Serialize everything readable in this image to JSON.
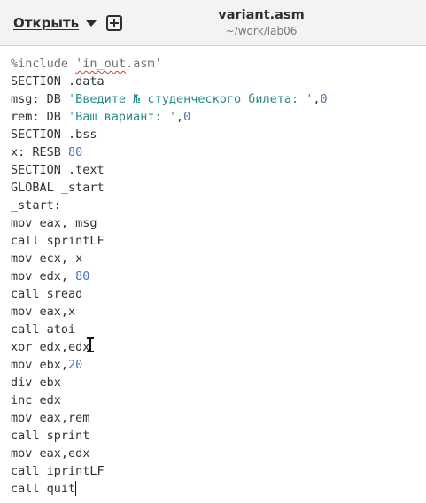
{
  "header": {
    "open_label": "Открыть",
    "title": "variant.asm",
    "subtitle": "~/work/lab06",
    "icons": {
      "open_menu": "chevron-down-icon",
      "new_tab": "new-document-icon"
    }
  },
  "editor": {
    "lines": [
      [
        {
          "t": "%include ",
          "c": "dir"
        },
        {
          "t": "'in_out",
          "c": "dir misspelled"
        },
        {
          "t": ".asm'",
          "c": "dir"
        }
      ],
      [
        {
          "t": "SECTION .data",
          "c": ""
        }
      ],
      [
        {
          "t": "msg: DB ",
          "c": ""
        },
        {
          "t": "'Введите № студенческого билета: '",
          "c": "str"
        },
        {
          "t": ",",
          "c": ""
        },
        {
          "t": "0",
          "c": "num"
        }
      ],
      [
        {
          "t": "rem: DB ",
          "c": ""
        },
        {
          "t": "'Ваш вариант: '",
          "c": "str"
        },
        {
          "t": ",",
          "c": ""
        },
        {
          "t": "0",
          "c": "num"
        }
      ],
      [
        {
          "t": "SECTION .bss",
          "c": ""
        }
      ],
      [
        {
          "t": "x: RESB ",
          "c": ""
        },
        {
          "t": "80",
          "c": "num"
        }
      ],
      [
        {
          "t": "SECTION .text",
          "c": ""
        }
      ],
      [
        {
          "t": "GLOBAL _start",
          "c": ""
        }
      ],
      [
        {
          "t": "_start:",
          "c": ""
        }
      ],
      [
        {
          "t": "mov eax, msg",
          "c": ""
        }
      ],
      [
        {
          "t": "call sprintLF",
          "c": ""
        }
      ],
      [
        {
          "t": "mov ecx, x",
          "c": ""
        }
      ],
      [
        {
          "t": "mov edx, ",
          "c": ""
        },
        {
          "t": "80",
          "c": "num"
        }
      ],
      [
        {
          "t": "call sread",
          "c": ""
        }
      ],
      [
        {
          "t": "mov eax,x",
          "c": ""
        }
      ],
      [
        {
          "t": "call atoi",
          "c": ""
        }
      ],
      [
        {
          "t": "xor edx,edx",
          "c": ""
        }
      ],
      [
        {
          "t": "mov ebx,",
          "c": ""
        },
        {
          "t": "20",
          "c": "num"
        }
      ],
      [
        {
          "t": "div ebx",
          "c": ""
        }
      ],
      [
        {
          "t": "inc edx",
          "c": ""
        }
      ],
      [
        {
          "t": "mov eax,rem",
          "c": ""
        }
      ],
      [
        {
          "t": "call sprint",
          "c": ""
        }
      ],
      [
        {
          "t": "mov eax,edx",
          "c": ""
        }
      ],
      [
        {
          "t": "call iprintLF",
          "c": ""
        }
      ],
      [
        {
          "t": "call quit",
          "c": ""
        }
      ]
    ],
    "caret_line": 24,
    "colors": {
      "number": "#4a6fb5",
      "string": "#258a8a",
      "directive": "#6f6f6f",
      "text": "#2e3436",
      "spellcheck": "#d9383a"
    }
  }
}
